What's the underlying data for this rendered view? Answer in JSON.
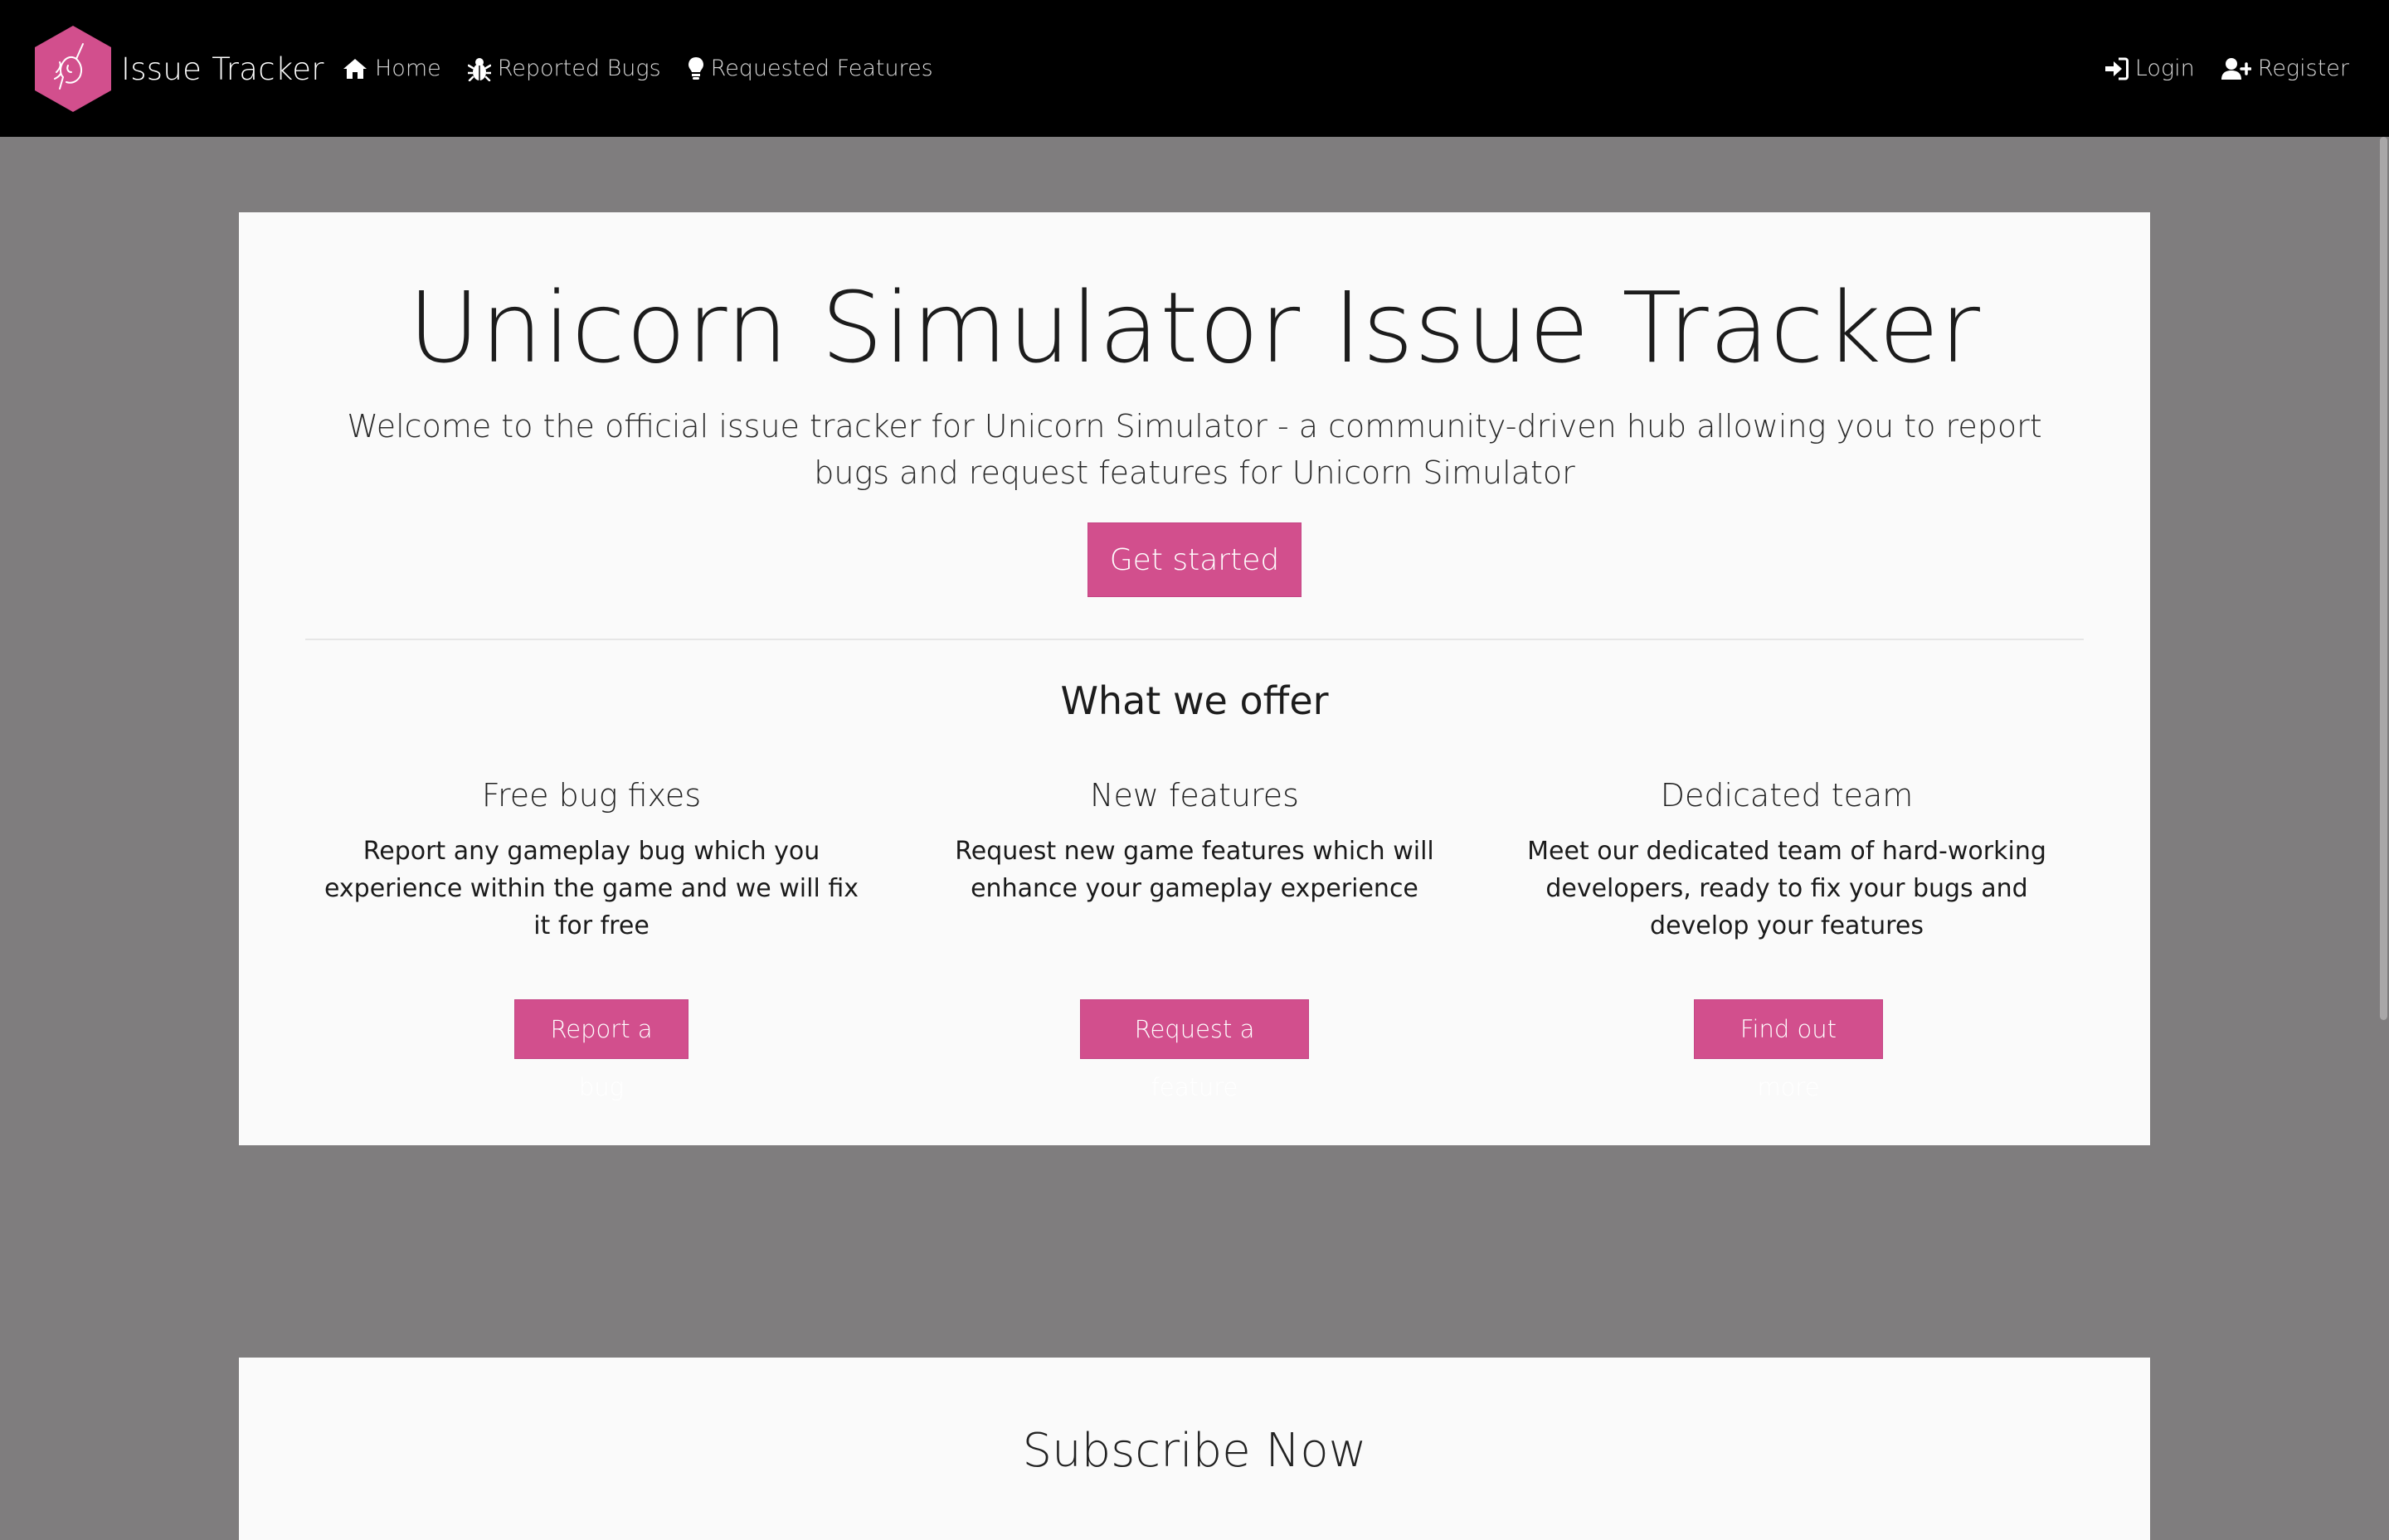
{
  "navbar": {
    "brand": "Issue Tracker",
    "links_left": [
      {
        "label": "Home",
        "icon": "home-icon"
      },
      {
        "label": "Reported Bugs",
        "icon": "bug-icon"
      },
      {
        "label": "Requested Features",
        "icon": "lightbulb-icon"
      }
    ],
    "links_right": [
      {
        "label": "Login",
        "icon": "sign-in-icon"
      },
      {
        "label": "Register",
        "icon": "user-plus-icon"
      }
    ]
  },
  "hero": {
    "title": "Unicorn Simulator Issue Tracker",
    "lead": "Welcome to the official issue tracker for Unicorn Simulator - a community-driven hub allowing you to report bugs and request features for Unicorn Simulator",
    "cta": "Get started"
  },
  "offer": {
    "title": "What we offer",
    "items": [
      {
        "title": "Free bug fixes",
        "text": "Report any gameplay bug which you experience within the game and we will fix it for free",
        "button": "Report a bug"
      },
      {
        "title": "New features",
        "text": "Request new game features which will enhance your gameplay experience",
        "button": "Request a feature"
      },
      {
        "title": "Dedicated team",
        "text": "Meet our dedicated team of hard-working developers, ready to fix your bugs and develop your features",
        "button": "Find out more"
      }
    ]
  },
  "subscribe": {
    "title": "Subscribe Now"
  },
  "colors": {
    "accent": "#d24f8d",
    "navbar_bg": "#000000",
    "page_bg": "#7f7d7e",
    "card_bg": "#fafafa"
  }
}
